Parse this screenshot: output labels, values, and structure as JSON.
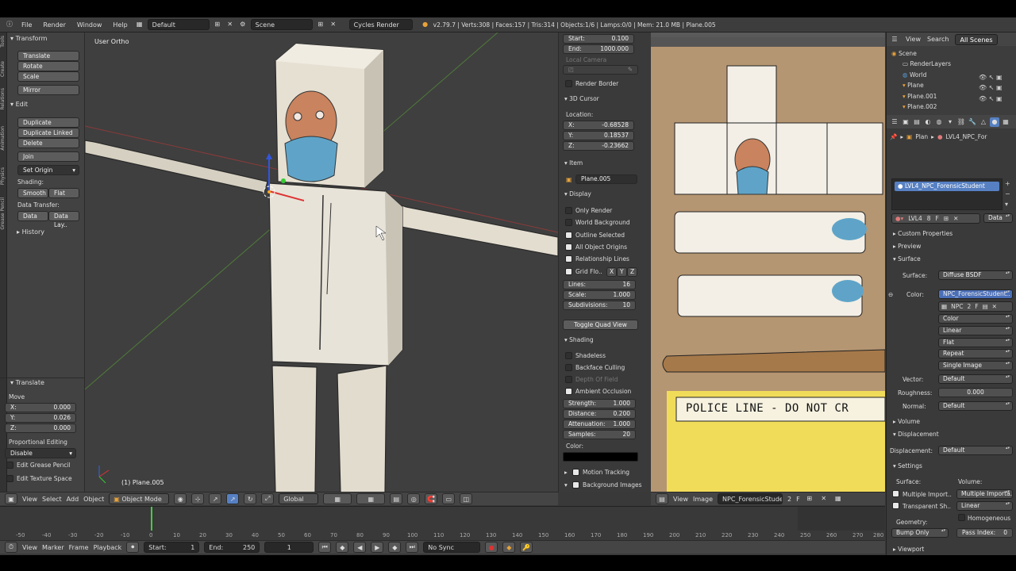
{
  "infobar": {
    "menus": [
      "File",
      "Render",
      "Window",
      "Help"
    ],
    "layout": "Default",
    "scene": "Scene",
    "engine": "Cycles Render",
    "stats": "v2.79.7 | Verts:308 | Faces:157 | Tris:314 | Objects:1/6 | Lamps:0/0 | Mem: 21.0 MB | Plane.005"
  },
  "tabs": [
    "Tools",
    "Create",
    "Relations",
    "Animation",
    "Physics",
    "Grease Pencil"
  ],
  "tool": {
    "transform_title": "Transform",
    "translate": "Translate",
    "rotate": "Rotate",
    "scale": "Scale",
    "mirror": "Mirror",
    "edit_title": "Edit",
    "duplicate": "Duplicate",
    "duplicate_linked": "Duplicate Linked",
    "delete": "Delete",
    "join": "Join",
    "set_origin": "Set Origin",
    "shading_label": "Shading:",
    "smooth": "Smooth",
    "flat": "Flat",
    "data_transfer_label": "Data Transfer:",
    "data": "Data",
    "data_lay": "Data Lay..",
    "history": "History",
    "op_title": "Translate",
    "move_label": "Move",
    "x_label": "X:",
    "x_val": "0.000",
    "y_label": "Y:",
    "y_val": "0.026",
    "z_label": "Z:",
    "z_val": "0.000",
    "prop_editing_label": "Proportional Editing",
    "prop_editing_val": "Disable",
    "edit_grease": "Edit Grease Pencil",
    "edit_texture": "Edit Texture Space"
  },
  "viewport": {
    "view_label": "User Ortho",
    "object_label": "(1) Plane.005",
    "header": {
      "view": "View",
      "select": "Select",
      "add": "Add",
      "object": "Object",
      "mode": "Object Mode",
      "orientation": "Global"
    }
  },
  "npanel": {
    "start_label": "Start:",
    "start_val": "0.100",
    "end_label": "End:",
    "end_val": "1000.000",
    "local_camera": "Local Camera",
    "render_border": "Render Border",
    "cursor_title": "3D Cursor",
    "location_label": "Location:",
    "cx_label": "X:",
    "cx_val": "-0.68528",
    "cy_label": "Y:",
    "cy_val": "0.18537",
    "cz_label": "Z:",
    "cz_val": "-0.23662",
    "item_title": "Item",
    "item_name": "Plane.005",
    "display_title": "Display",
    "only_render": "Only Render",
    "world_background": "World Background",
    "outline_selected": "Outline Selected",
    "all_object_origins": "All Object Origins",
    "relationship_lines": "Relationship Lines",
    "grid_floor": "Grid Flo..",
    "axis_x": "X",
    "axis_y": "Y",
    "axis_z": "Z",
    "lines_label": "Lines:",
    "lines_val": "16",
    "scale_label": "Scale:",
    "scale_val": "1.000",
    "subdiv_label": "Subdivisions:",
    "subdiv_val": "10",
    "toggle_quad": "Toggle Quad View",
    "shading_title": "Shading",
    "shadeless": "Shadeless",
    "backface": "Backface Culling",
    "dof": "Depth Of Field",
    "ao": "Ambient Occlusion",
    "strength_label": "Strength:",
    "strength_val": "1.000",
    "distance_label": "Distance:",
    "distance_val": "0.200",
    "atten_label": "Attenuation:",
    "atten_val": "1.000",
    "samples_label": "Samples:",
    "samples_val": "20",
    "color_label": "Color:",
    "motion_tracking": "Motion Tracking",
    "background_images": "Background Images"
  },
  "image_editor": {
    "police_text": "POLICE LINE - DO NOT CR",
    "header": {
      "view": "View",
      "image": "Image",
      "image_name": "NPC_ForensicStuden..",
      "users": "2",
      "fake": "F"
    }
  },
  "outliner": {
    "view": "View",
    "search": "Search",
    "scope": "All Scenes",
    "items": [
      "Scene",
      "RenderLayers",
      "World",
      "Plane",
      "Plane.001",
      "Plane.002"
    ]
  },
  "props": {
    "breadcrumb_obj": "Plan",
    "breadcrumb_mat": "LVL4_NPC_For",
    "material_slot": "LVL4_NPC_ForensicStudent",
    "mat_name": "LVL4",
    "mat_users": "8",
    "mat_fake": "F",
    "data_label": "Data",
    "custom_props": "Custom Properties",
    "preview": "Preview",
    "surface_title": "Surface",
    "surface_label": "Surface:",
    "surface_val": "Diffuse BSDF",
    "color_label": "Color:",
    "color_val": "NPC_ForensicStudent..",
    "tex_name": "NPC",
    "tex_users": "2",
    "tex_fake": "F",
    "opt_color": "Color",
    "opt_linear": "Linear",
    "opt_flat": "Flat",
    "opt_repeat": "Repeat",
    "opt_single": "Single Image",
    "vector_label": "Vector:",
    "vector_val": "Default",
    "roughness_label": "Roughness:",
    "roughness_val": "0.000",
    "normal_label": "Normal:",
    "normal_val": "Default",
    "volume": "Volume",
    "displacement_title": "Displacement",
    "displacement_label": "Displacement:",
    "displacement_val": "Default",
    "settings_title": "Settings",
    "surface2_label": "Surface:",
    "volume2_label": "Volume:",
    "multi_import1": "Multiple Import..",
    "multi_import2": "Multiple Importa..",
    "transparent_sh": "Transparent Sh..",
    "linear2": "Linear",
    "homogeneous": "Homogeneous",
    "geometry_label": "Geometry:",
    "bump_only": "Bump Only",
    "pass_index_label": "Pass Index:",
    "pass_index_val": "0",
    "viewport": "Viewport"
  },
  "timeline": {
    "ticks": [
      "-50",
      "-40",
      "-30",
      "-20",
      "-10",
      "0",
      "10",
      "20",
      "30",
      "40",
      "50",
      "60",
      "70",
      "80",
      "90",
      "100",
      "110",
      "120",
      "130",
      "140",
      "150",
      "160",
      "170",
      "180",
      "190",
      "200",
      "210",
      "220",
      "230",
      "240",
      "250",
      "260",
      "270",
      "280"
    ],
    "view": "View",
    "marker": "Marker",
    "frame": "Frame",
    "playback": "Playback",
    "start_label": "Start:",
    "start_val": "1",
    "end_label": "End:",
    "end_val": "250",
    "current": "1",
    "sync": "No Sync"
  },
  "colors": {
    "accent": "#5680c2",
    "selected_field": "#4b6fb7",
    "bg": "#393939"
  }
}
